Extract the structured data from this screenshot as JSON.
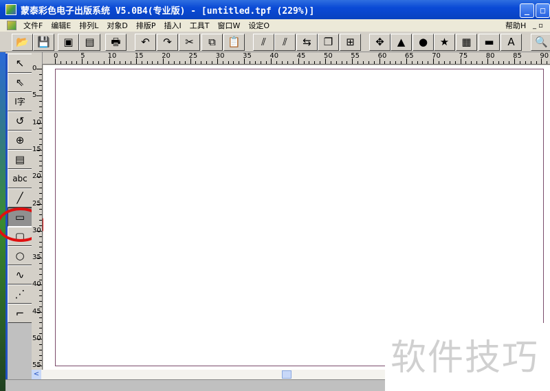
{
  "window": {
    "title": "蒙泰彩色电子出版系统 V5.0B4(专业版) - [untitled.tpf (229%)]"
  },
  "menu": {
    "items": [
      "文件F",
      "编辑E",
      "排列L",
      "对象D",
      "排版P",
      "插入I",
      "工具T",
      "窗口W",
      "设定O"
    ],
    "help": "帮助H"
  },
  "toolbar": {
    "buttons": [
      {
        "name": "open-icon",
        "glyph": "📂"
      },
      {
        "name": "save-icon",
        "glyph": "💾"
      },
      {
        "name": "import-icon",
        "glyph": "▣"
      },
      {
        "name": "export-icon",
        "glyph": "▤"
      },
      {
        "name": "print-icon",
        "glyph": "🖶"
      },
      {
        "name": "undo-icon",
        "glyph": "↶"
      },
      {
        "name": "redo-icon",
        "glyph": "↷"
      },
      {
        "name": "cut-icon",
        "glyph": "✂"
      },
      {
        "name": "copy-icon",
        "glyph": "⧉"
      },
      {
        "name": "paste-icon",
        "glyph": "📋"
      },
      {
        "name": "bring-forward-icon",
        "glyph": "⫽"
      },
      {
        "name": "send-backward-icon",
        "glyph": "⫽"
      },
      {
        "name": "align-icon",
        "glyph": "⇆"
      },
      {
        "name": "layers-icon",
        "glyph": "❐"
      },
      {
        "name": "group-icon",
        "glyph": "⊞"
      },
      {
        "name": "move-icon",
        "glyph": "✥"
      },
      {
        "name": "shapes-icon",
        "glyph": "▲"
      },
      {
        "name": "color-icon",
        "glyph": "●"
      },
      {
        "name": "star-icon",
        "glyph": "★"
      },
      {
        "name": "warp-icon",
        "glyph": "▦"
      },
      {
        "name": "image-icon",
        "glyph": "▬"
      },
      {
        "name": "table-icon",
        "glyph": "A"
      },
      {
        "name": "preview-icon",
        "glyph": "🔍"
      }
    ]
  },
  "left_tools": [
    {
      "name": "select-tool",
      "glyph": "↖"
    },
    {
      "name": "node-select-tool",
      "glyph": "⇖"
    },
    {
      "name": "text-tool",
      "glyph": "I字"
    },
    {
      "name": "rotate-tool",
      "glyph": "↺"
    },
    {
      "name": "zoom-tool",
      "glyph": "⊕"
    },
    {
      "name": "page-tool",
      "glyph": "▤"
    },
    {
      "name": "abc-text-tool",
      "glyph": "abc"
    },
    {
      "name": "line-tool",
      "glyph": "╱"
    },
    {
      "name": "rectangle-tool",
      "glyph": "▭",
      "active": true
    },
    {
      "name": "rounded-rect-tool",
      "glyph": "▢"
    },
    {
      "name": "ellipse-tool",
      "glyph": "○"
    },
    {
      "name": "curve-tool",
      "glyph": "∿"
    },
    {
      "name": "polyline-tool",
      "glyph": "⋰"
    },
    {
      "name": "connector-tool",
      "glyph": "⌐"
    }
  ],
  "ruler": {
    "top_labels": [
      "0",
      "5",
      "10",
      "15",
      "20",
      "25",
      "30",
      "35",
      "40",
      "45",
      "50",
      "55",
      "60",
      "65",
      "70",
      "75",
      "80",
      "85",
      "90"
    ],
    "left_labels": [
      "0",
      "5",
      "10",
      "15",
      "20",
      "25",
      "30",
      "35",
      "40",
      "45",
      "50",
      "55"
    ]
  },
  "watermark": "软件技巧"
}
